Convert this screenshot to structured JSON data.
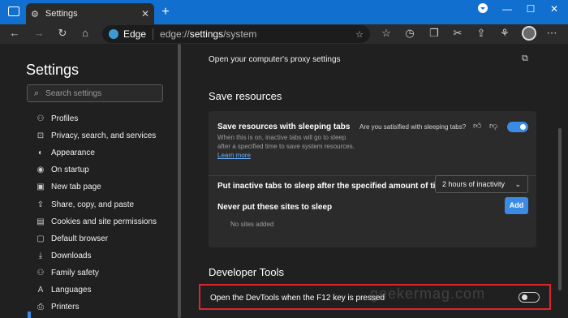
{
  "browser": {
    "tab_title": "Settings",
    "tab_close": "✕",
    "new_tab": "+",
    "window_controls": [
      "⌄",
      "—",
      "☐",
      "✕"
    ],
    "brand": "Edge",
    "url_prefix": "edge://",
    "url_bold": "settings",
    "url_suffix": "/system"
  },
  "sidebar": {
    "title": "Settings",
    "search_placeholder": "Search settings",
    "items": [
      {
        "label": "Profiles",
        "icon": "person-icon",
        "glyph": "⚇"
      },
      {
        "label": "Privacy, search, and services",
        "icon": "lock-icon",
        "glyph": "🔒"
      },
      {
        "label": "Appearance",
        "icon": "palette-icon",
        "glyph": "◐"
      },
      {
        "label": "On startup",
        "icon": "power-icon",
        "glyph": "⏻"
      },
      {
        "label": "New tab page",
        "icon": "newtab-icon",
        "glyph": "▣"
      },
      {
        "label": "Share, copy, and paste",
        "icon": "share-icon",
        "glyph": "⇪"
      },
      {
        "label": "Cookies and site permissions",
        "icon": "cookies-icon",
        "glyph": "▤"
      },
      {
        "label": "Default browser",
        "icon": "browser-icon",
        "glyph": "▢"
      },
      {
        "label": "Downloads",
        "icon": "download-icon",
        "glyph": "⤓"
      },
      {
        "label": "Family safety",
        "icon": "family-icon",
        "glyph": "⚇"
      },
      {
        "label": "Languages",
        "icon": "languages-icon",
        "glyph": "A"
      },
      {
        "label": "Printers",
        "icon": "printer-icon",
        "glyph": "⎙"
      }
    ]
  },
  "main": {
    "proxy_label": "Open your computer's proxy settings",
    "save_resources": {
      "heading": "Save resources",
      "sleeping_tabs_title": "Save resources with sleeping tabs",
      "sleeping_tabs_desc": "When this is on, inactive tabs will go to sleep after a specified time to save system resources.",
      "learn_more": "Learn more",
      "question": "Are you satisified with sleeping tabs?",
      "sleeping_tabs_enabled": true,
      "inactive_label": "Put inactive tabs to sleep after the specified amount of time:",
      "inactive_value": "2 hours of inactivity",
      "never_sleep_label": "Never put these sites to sleep",
      "add_label": "Add",
      "no_sites": "No sites added"
    },
    "developer_tools": {
      "heading": "Developer Tools",
      "f12_label": "Open the DevTools when the F12 key is pressed",
      "f12_enabled": false
    },
    "watermark": "geekermag.com"
  },
  "colors": {
    "accent": "#3a8be4",
    "titlebar": "#1170cf",
    "highlight": "#e0242c"
  }
}
